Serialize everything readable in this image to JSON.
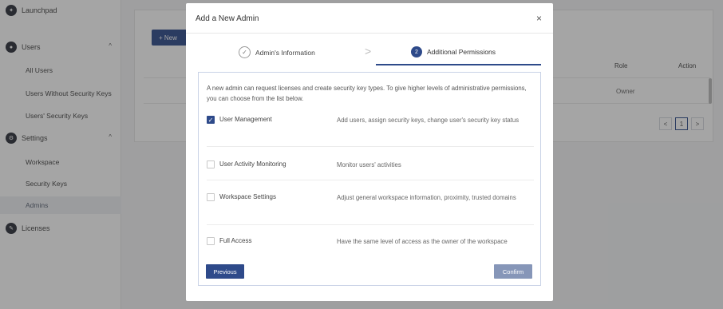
{
  "sidebar": {
    "launchpad": "Launchpad",
    "users": "Users",
    "users_sub": [
      "All Users",
      "Users Without Security Keys",
      "Users' Security Keys"
    ],
    "settings": "Settings",
    "settings_sub": [
      "Workspace",
      "Security Keys",
      "Admins"
    ],
    "licenses": "Licenses",
    "chevron": "^"
  },
  "main": {
    "new_button": "+ New",
    "table_headers": {
      "role": "Role",
      "action": "Action"
    },
    "rows": [
      {
        "role": "Owner"
      }
    ],
    "pagination": {
      "prev": "<",
      "page": "1",
      "next": ">"
    }
  },
  "modal": {
    "title": "Add a New Admin",
    "close": "×",
    "steps": [
      {
        "label": "Admin's Information",
        "marker": "✓"
      },
      {
        "label": "Additional Permissions",
        "marker": "2"
      }
    ],
    "step_separator": ">",
    "description": "A new admin can request licenses and create security key types. To give higher levels of administrative permissions, you can choose from the list below.",
    "permissions": [
      {
        "name": "User Management",
        "description": "Add users, assign security keys, change user's security key status",
        "checked": true
      },
      {
        "name": "User Activity Monitoring",
        "description": "Monitor users' activities",
        "checked": false
      },
      {
        "name": "Workspace Settings",
        "description": "Adjust general workspace information, proximity, trusted domains",
        "checked": false
      },
      {
        "name": "Full Access",
        "description": "Have the same level of access as the owner of the workspace",
        "checked": false
      }
    ],
    "buttons": {
      "previous": "Previous",
      "confirm": "Confirm"
    }
  },
  "colors": {
    "primary": "#2e4a8a",
    "confirm_disabled": "#8696b8",
    "overlay": "rgba(40,40,40,0.42)"
  }
}
